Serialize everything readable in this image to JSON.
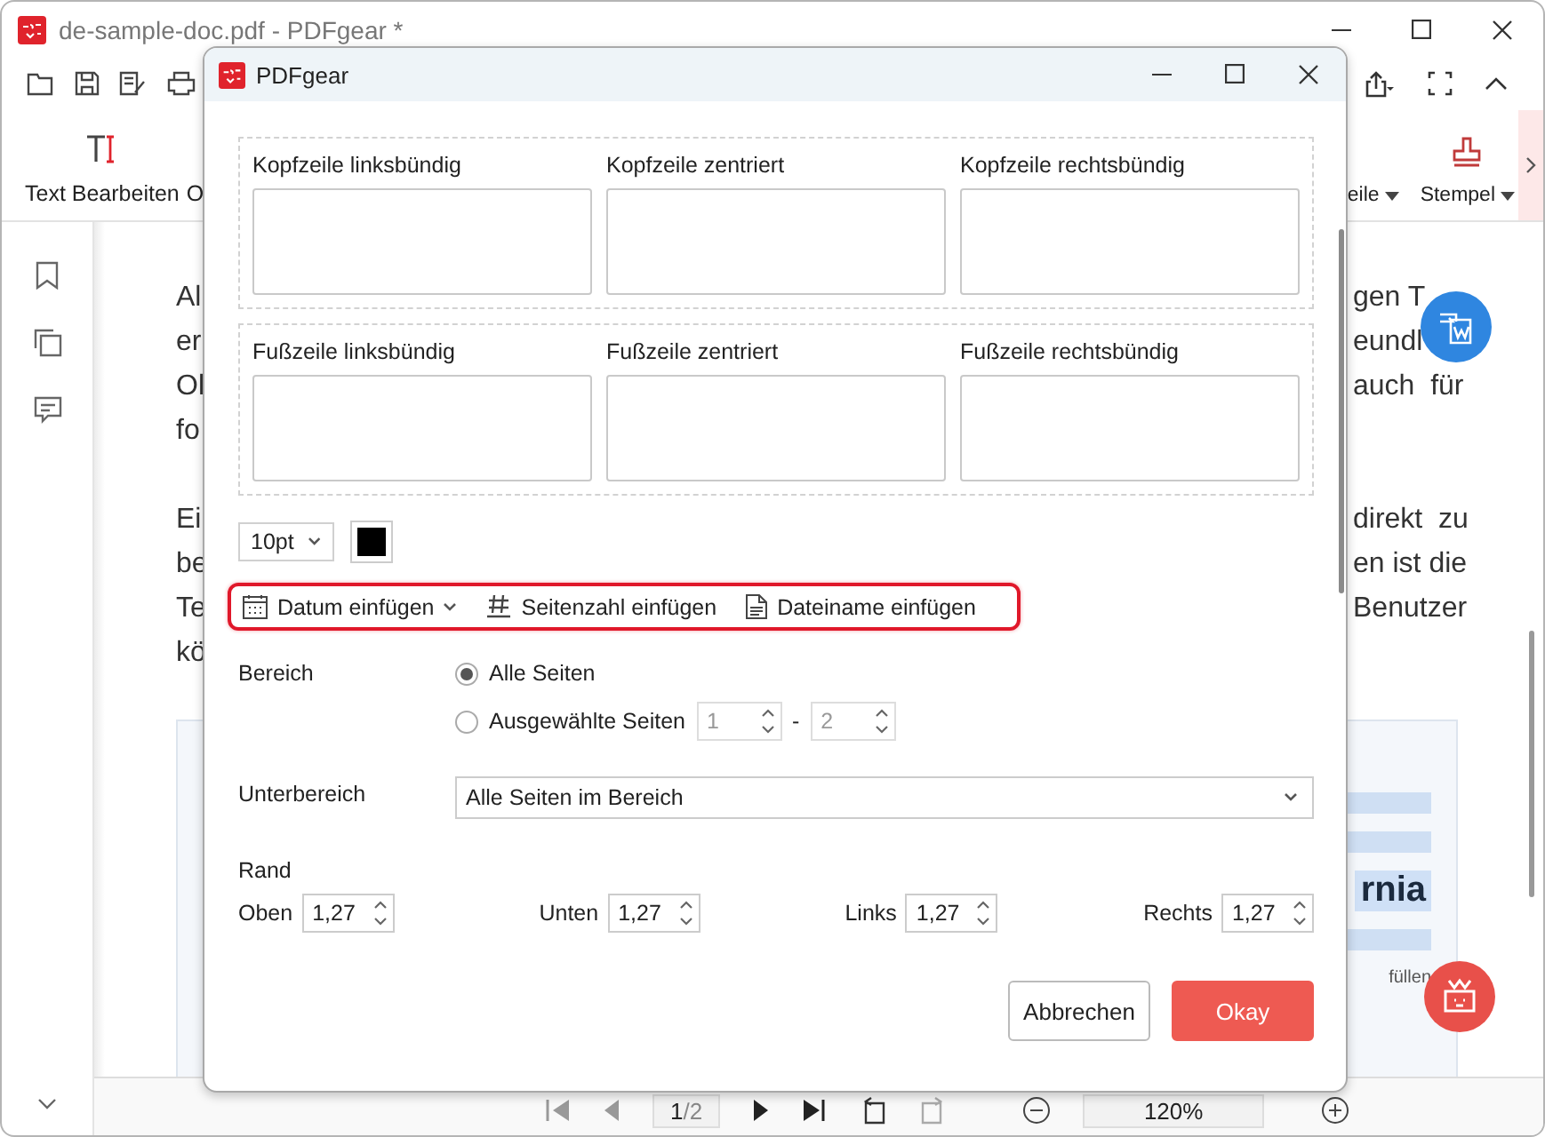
{
  "app_window": {
    "title": "de-sample-doc.pdf - PDFgear *"
  },
  "ribbon_left": [
    {
      "label": "Text Bearbeiten",
      "kind": "text-edit"
    },
    {
      "label": "O",
      "kind": "plain"
    }
  ],
  "ribbon_right": [
    {
      "label": "eile",
      "kind": "dropdown"
    },
    {
      "label": "Stempel",
      "kind": "stamp"
    }
  ],
  "document": {
    "paragraphs": [
      {
        "lines": [
          {
            "left": "Al",
            "right": "gen T"
          },
          {
            "left": "er",
            "right": "eundl"
          },
          {
            "left": "Ol",
            "right": "auch  für"
          },
          {
            "left": "fo"
          }
        ]
      },
      {
        "lines": [
          {
            "left": "Ei",
            "right": "direkt  zu"
          },
          {
            "left": "be",
            "right": "en ist die"
          },
          {
            "left": "Te",
            "right": "Benutzer"
          },
          {
            "left": "kö"
          }
        ]
      }
    ],
    "figure": {
      "highlighted_text": "rnia",
      "caption": "füllen"
    }
  },
  "pager": {
    "page": "1",
    "count": "/2",
    "zoom": "120%"
  },
  "dialog": {
    "title": "PDFgear",
    "header_fields": [
      "Kopfzeile linksbündig",
      "Kopfzeile zentriert",
      "Kopfzeile rechtsbündig"
    ],
    "footer_fields": [
      "Fußzeile linksbündig",
      "Fußzeile zentriert",
      "Fußzeile rechtsbündig"
    ],
    "font_size": "10pt",
    "insert_buttons": [
      {
        "label": "Datum einfügen",
        "kind": "date"
      },
      {
        "label": "Seitenzahl einfügen",
        "kind": "page-number"
      },
      {
        "label": "Dateiname einfügen",
        "kind": "file-name"
      }
    ],
    "range": {
      "label": "Bereich",
      "options": [
        {
          "label": "Alle Seiten",
          "selected": true
        },
        {
          "label": "Ausgewählte Seiten",
          "selected": false
        }
      ],
      "from": "1",
      "separator": "-",
      "to": "2",
      "disabled": true
    },
    "subrange": {
      "label": "Unterbereich",
      "value": "Alle Seiten im Bereich"
    },
    "margin": {
      "label": "Rand",
      "fields": [
        {
          "label": "Oben",
          "value": "1,27"
        },
        {
          "label": "Unten",
          "value": "1,27"
        },
        {
          "label": "Links",
          "value": "1,27"
        },
        {
          "label": "Rechts",
          "value": "1,27"
        }
      ]
    },
    "buttons": [
      {
        "label": "Abbrechen",
        "kind": "secondary"
      },
      {
        "label": "Okay",
        "kind": "primary"
      }
    ]
  }
}
